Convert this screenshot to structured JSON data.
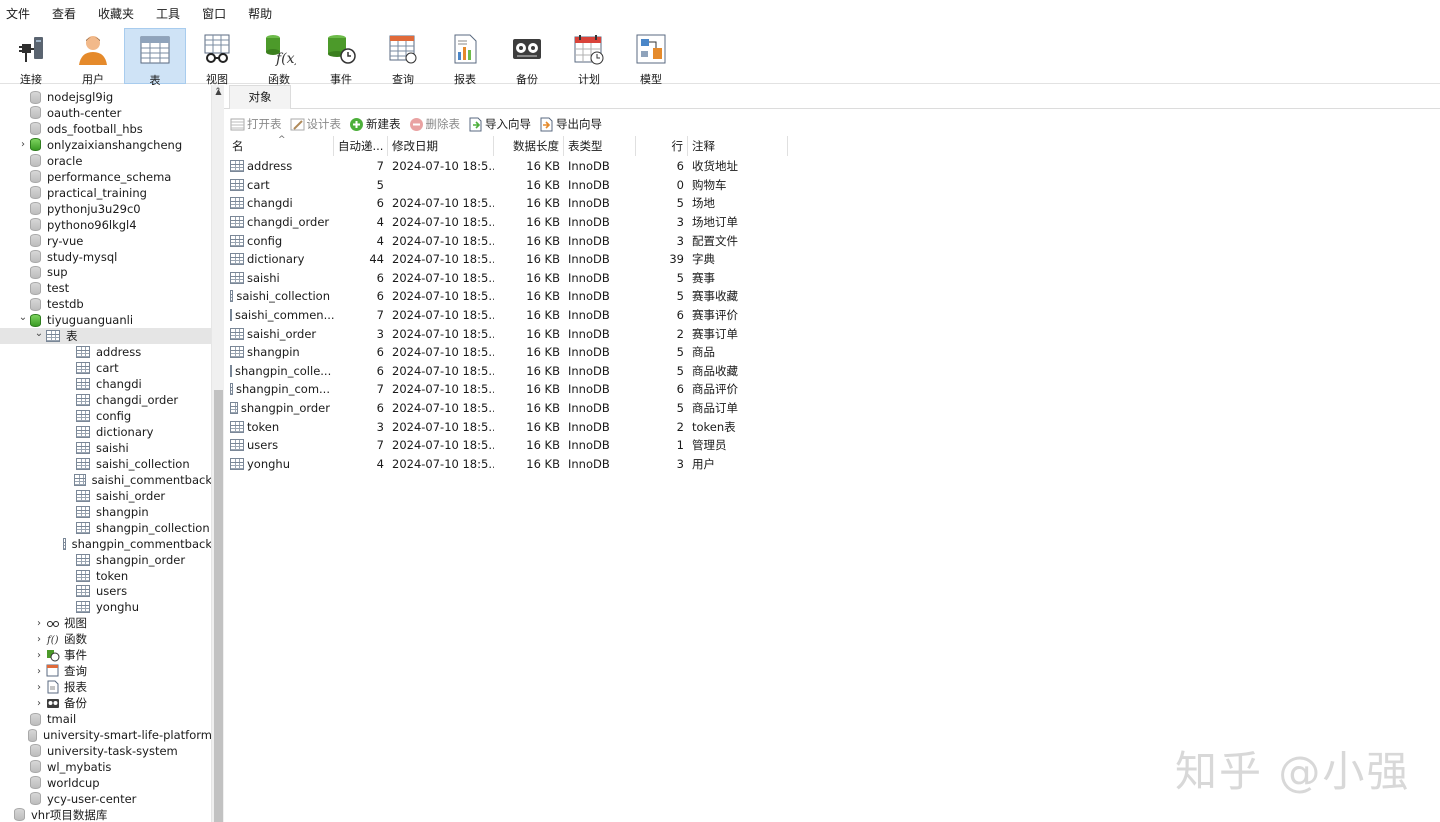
{
  "menu": [
    "文件",
    "查看",
    "收藏夹",
    "工具",
    "窗口",
    "帮助"
  ],
  "toolbar": [
    {
      "label": "连接",
      "icon": "plug-icon"
    },
    {
      "label": "用户",
      "icon": "user-icon"
    },
    {
      "label": "表",
      "icon": "table-icon",
      "active": true
    },
    {
      "label": "视图",
      "icon": "view-icon"
    },
    {
      "label": "函数",
      "icon": "function-icon"
    },
    {
      "label": "事件",
      "icon": "event-icon"
    },
    {
      "label": "查询",
      "icon": "query-icon"
    },
    {
      "label": "报表",
      "icon": "report-icon"
    },
    {
      "label": "备份",
      "icon": "backup-icon"
    },
    {
      "label": "计划",
      "icon": "schedule-icon"
    },
    {
      "label": "模型",
      "icon": "model-icon"
    }
  ],
  "sidebar": {
    "databases_top": [
      {
        "name": "nodejsgl9ig",
        "open": false
      },
      {
        "name": "oauth-center",
        "open": false
      },
      {
        "name": "ods_football_hbs",
        "open": false
      },
      {
        "name": "onlyzaixianshangcheng",
        "open": true,
        "expandable": true
      },
      {
        "name": "oracle",
        "open": false
      },
      {
        "name": "performance_schema",
        "open": false
      },
      {
        "name": "practical_training",
        "open": false
      },
      {
        "name": "pythonju3u29c0",
        "open": false
      },
      {
        "name": "pythono96lkgl4",
        "open": false
      },
      {
        "name": "ry-vue",
        "open": false
      },
      {
        "name": "study-mysql",
        "open": false
      },
      {
        "name": "sup",
        "open": false
      },
      {
        "name": "test",
        "open": false
      },
      {
        "name": "testdb",
        "open": false
      }
    ],
    "active_db": "tiyuguanguanli",
    "tables_node": "表",
    "tables": [
      "address",
      "cart",
      "changdi",
      "changdi_order",
      "config",
      "dictionary",
      "saishi",
      "saishi_collection",
      "saishi_commentback",
      "saishi_order",
      "shangpin",
      "shangpin_collection",
      "shangpin_commentback",
      "shangpin_order",
      "token",
      "users",
      "yonghu"
    ],
    "subnodes": [
      {
        "label": "视图",
        "icon": "view-icon"
      },
      {
        "label": "函数",
        "icon": "function-icon"
      },
      {
        "label": "事件",
        "icon": "event-icon"
      },
      {
        "label": "查询",
        "icon": "query-icon"
      },
      {
        "label": "报表",
        "icon": "report-icon"
      },
      {
        "label": "备份",
        "icon": "backup-icon"
      }
    ],
    "databases_bottom": [
      "tmail",
      "university-smart-life-platform",
      "university-task-system",
      "wl_mybatis",
      "worldcup",
      "ycy-user-center"
    ],
    "connection_bottom": "vhr项目数据库"
  },
  "tab": {
    "label": "对象"
  },
  "object_toolbar": [
    {
      "label": "打开表",
      "icon": "open-table-icon",
      "enabled": false
    },
    {
      "label": "设计表",
      "icon": "design-table-icon",
      "enabled": false
    },
    {
      "label": "新建表",
      "icon": "new-table-icon",
      "enabled": true
    },
    {
      "label": "删除表",
      "icon": "delete-table-icon",
      "enabled": false
    },
    {
      "label": "导入向导",
      "icon": "import-wizard-icon",
      "enabled": true
    },
    {
      "label": "导出向导",
      "icon": "export-wizard-icon",
      "enabled": true
    }
  ],
  "grid": {
    "columns": [
      "名",
      "自动递...",
      "修改日期",
      "数据长度",
      "表类型",
      "行",
      "注释"
    ],
    "rows": [
      {
        "name": "address",
        "auto": "7",
        "date": "2024-07-10 18:5...",
        "size": "16 KB",
        "engine": "InnoDB",
        "rows": "6",
        "comment": "收货地址"
      },
      {
        "name": "cart",
        "auto": "5",
        "date": "",
        "size": "16 KB",
        "engine": "InnoDB",
        "rows": "0",
        "comment": "购物车"
      },
      {
        "name": "changdi",
        "auto": "6",
        "date": "2024-07-10 18:5...",
        "size": "16 KB",
        "engine": "InnoDB",
        "rows": "5",
        "comment": "场地"
      },
      {
        "name": "changdi_order",
        "auto": "4",
        "date": "2024-07-10 18:5...",
        "size": "16 KB",
        "engine": "InnoDB",
        "rows": "3",
        "comment": "场地订单"
      },
      {
        "name": "config",
        "auto": "4",
        "date": "2024-07-10 18:5...",
        "size": "16 KB",
        "engine": "InnoDB",
        "rows": "3",
        "comment": "配置文件"
      },
      {
        "name": "dictionary",
        "auto": "44",
        "date": "2024-07-10 18:5...",
        "size": "16 KB",
        "engine": "InnoDB",
        "rows": "39",
        "comment": "字典"
      },
      {
        "name": "saishi",
        "auto": "6",
        "date": "2024-07-10 18:5...",
        "size": "16 KB",
        "engine": "InnoDB",
        "rows": "5",
        "comment": "赛事"
      },
      {
        "name": "saishi_collection",
        "auto": "6",
        "date": "2024-07-10 18:5...",
        "size": "16 KB",
        "engine": "InnoDB",
        "rows": "5",
        "comment": "赛事收藏"
      },
      {
        "name": "saishi_commen...",
        "auto": "7",
        "date": "2024-07-10 18:5...",
        "size": "16 KB",
        "engine": "InnoDB",
        "rows": "6",
        "comment": "赛事评价"
      },
      {
        "name": "saishi_order",
        "auto": "3",
        "date": "2024-07-10 18:5...",
        "size": "16 KB",
        "engine": "InnoDB",
        "rows": "2",
        "comment": "赛事订单"
      },
      {
        "name": "shangpin",
        "auto": "6",
        "date": "2024-07-10 18:5...",
        "size": "16 KB",
        "engine": "InnoDB",
        "rows": "5",
        "comment": "商品"
      },
      {
        "name": "shangpin_colle...",
        "auto": "6",
        "date": "2024-07-10 18:5...",
        "size": "16 KB",
        "engine": "InnoDB",
        "rows": "5",
        "comment": "商品收藏"
      },
      {
        "name": "shangpin_com...",
        "auto": "7",
        "date": "2024-07-10 18:5...",
        "size": "16 KB",
        "engine": "InnoDB",
        "rows": "6",
        "comment": "商品评价"
      },
      {
        "name": "shangpin_order",
        "auto": "6",
        "date": "2024-07-10 18:5...",
        "size": "16 KB",
        "engine": "InnoDB",
        "rows": "5",
        "comment": "商品订单"
      },
      {
        "name": "token",
        "auto": "3",
        "date": "2024-07-10 18:5...",
        "size": "16 KB",
        "engine": "InnoDB",
        "rows": "2",
        "comment": "token表"
      },
      {
        "name": "users",
        "auto": "7",
        "date": "2024-07-10 18:5...",
        "size": "16 KB",
        "engine": "InnoDB",
        "rows": "1",
        "comment": "管理员"
      },
      {
        "name": "yonghu",
        "auto": "4",
        "date": "2024-07-10 18:5...",
        "size": "16 KB",
        "engine": "InnoDB",
        "rows": "3",
        "comment": "用户"
      }
    ]
  },
  "watermark": "知乎 @小强"
}
